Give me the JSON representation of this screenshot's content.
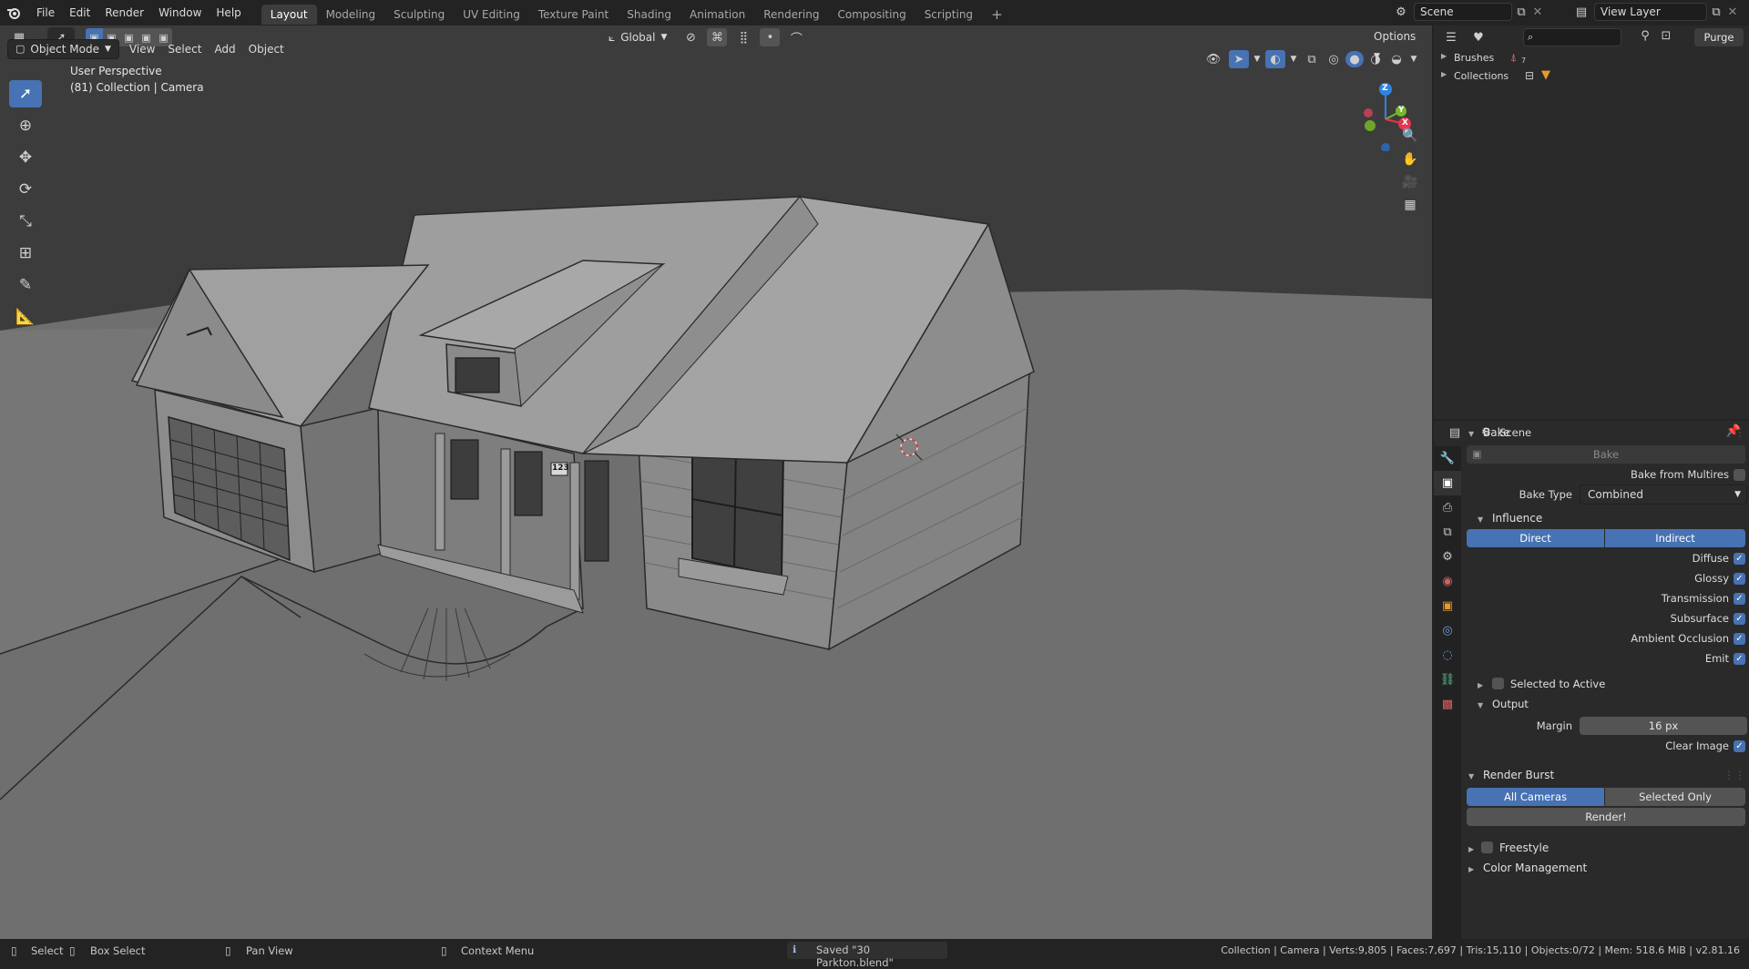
{
  "topbar": {
    "menus": [
      "File",
      "Edit",
      "Render",
      "Window",
      "Help"
    ],
    "workspaces": [
      "Layout",
      "Modeling",
      "Sculpting",
      "UV Editing",
      "Texture Paint",
      "Shading",
      "Animation",
      "Rendering",
      "Compositing",
      "Scripting"
    ],
    "active_workspace": "Layout",
    "add_tab": "+",
    "scene_name": "Scene",
    "view_layer": "View Layer"
  },
  "viewport": {
    "mode": "Object Mode",
    "menus": [
      "View",
      "Select",
      "Add",
      "Object"
    ],
    "transform_orientation": "Global",
    "options_label": "Options",
    "info_line1": "User Perspective",
    "info_line2": "(81) Collection | Camera",
    "gizmo_axes": {
      "z": "Z",
      "y": "Y",
      "x": "X"
    },
    "house_number": "123"
  },
  "outliner": {
    "purge_label": "Purge",
    "items": [
      {
        "label": "Brushes",
        "badge": "7"
      },
      {
        "label": "Collections"
      }
    ]
  },
  "properties": {
    "context": "Scene",
    "bake": {
      "header": "Bake",
      "bake_button": "Bake",
      "bake_from_multires_label": "Bake from Multires",
      "bake_from_multires": false,
      "bake_type_label": "Bake Type",
      "bake_type": "Combined",
      "influence": {
        "header": "Influence",
        "direct": "Direct",
        "indirect": "Indirect",
        "passes": [
          {
            "label": "Diffuse",
            "checked": true
          },
          {
            "label": "Glossy",
            "checked": true
          },
          {
            "label": "Transmission",
            "checked": true
          },
          {
            "label": "Subsurface",
            "checked": true
          },
          {
            "label": "Ambient Occlusion",
            "checked": true
          },
          {
            "label": "Emit",
            "checked": true
          }
        ]
      },
      "selected_to_active_label": "Selected to Active",
      "output": {
        "header": "Output",
        "margin_label": "Margin",
        "margin_value": "16 px",
        "clear_image_label": "Clear Image",
        "clear_image": true
      }
    },
    "render_burst": {
      "header": "Render Burst",
      "all_cameras": "All Cameras",
      "selected_only": "Selected Only",
      "render_button": "Render!"
    },
    "freestyle_label": "Freestyle",
    "color_management_label": "Color Management"
  },
  "statusbar": {
    "select": "Select",
    "box_select": "Box Select",
    "pan_view": "Pan View",
    "context_menu": "Context Menu",
    "saved_message": "Saved \"30 Parkton.blend\"",
    "stats": "Collection | Camera | Verts:9,805 | Faces:7,697 | Tris:15,110 | Objects:0/72 | Mem: 518.6 MiB | v2.81.16"
  },
  "colors": {
    "accent": "#4772b3",
    "axis_x": "#e8344f",
    "axis_y": "#77b72a",
    "axis_z": "#2f83e0"
  }
}
